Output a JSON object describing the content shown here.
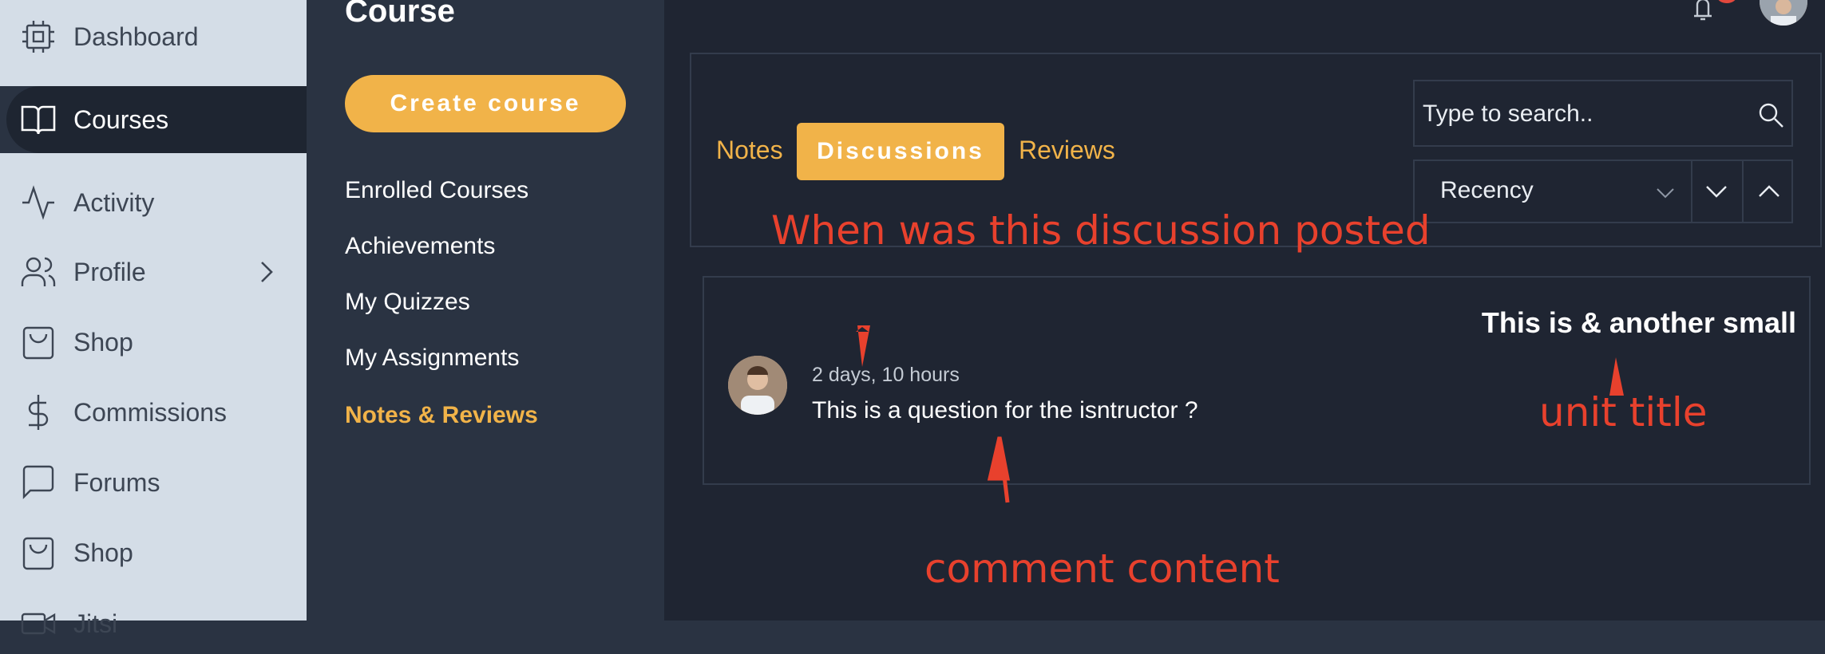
{
  "sidebar": {
    "items": [
      {
        "label": "Dashboard",
        "icon": "cpu-icon"
      },
      {
        "label": "Courses",
        "icon": "book-icon"
      },
      {
        "label": "Activity",
        "icon": "activity-icon"
      },
      {
        "label": "Profile",
        "icon": "users-icon"
      },
      {
        "label": "Shop",
        "icon": "shopping-bag-icon"
      },
      {
        "label": "Commissions",
        "icon": "dollar-icon"
      },
      {
        "label": "Forums",
        "icon": "message-square-icon"
      },
      {
        "label": "Shop",
        "icon": "shopping-bag-icon"
      },
      {
        "label": "Jitsi",
        "icon": "video-icon"
      }
    ]
  },
  "course_panel": {
    "title": "Course",
    "create_button": "Create course",
    "links": [
      "Enrolled Courses",
      "Achievements",
      "My Quizzes",
      "My Assignments",
      "Notes & Reviews"
    ]
  },
  "tabs": {
    "notes": "Notes",
    "discussions": "Discussions",
    "reviews": "Reviews"
  },
  "search": {
    "placeholder": "Type to search.."
  },
  "sort": {
    "value": "Recency"
  },
  "discussion": {
    "time": "2 days, 10 hours",
    "text": "This is a question for the isntructor ?",
    "unit_title": "This is & another small"
  },
  "annotations": {
    "posted": "When was this discussion posted",
    "unit_title": "unit title",
    "comment": "comment content"
  },
  "colors": {
    "accent": "#f1b349",
    "annotation": "#e8412d",
    "sidebar_bg": "#d4dde7",
    "main_bg": "#1f2532"
  }
}
